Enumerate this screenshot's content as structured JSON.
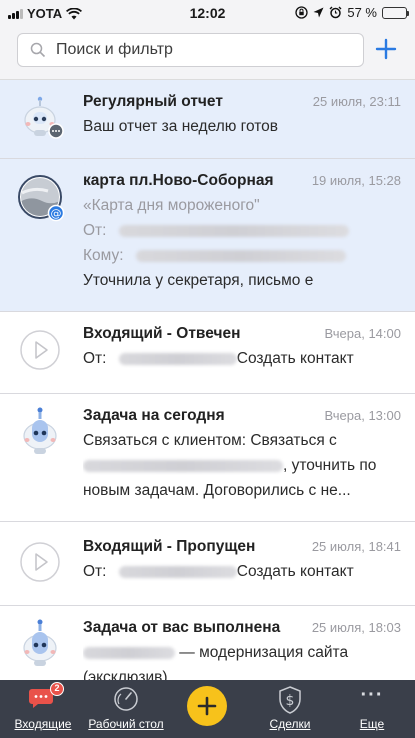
{
  "status_bar": {
    "carrier": "YOTA",
    "time": "12:02",
    "battery": "57 %",
    "battery_level": 0.57
  },
  "search": {
    "placeholder": "Поиск и фильтр"
  },
  "feed": [
    {
      "title": "Регулярный отчет",
      "time": "25 июля, 23:11",
      "line1": "Ваш отчет за неделю готов"
    },
    {
      "title": "карта пл.Ново-Соборная",
      "time": "19 июля, 15:28",
      "line1": "«Карта дня мороженого\"",
      "from_label": "От:",
      "to_label": "Кому:",
      "snippet": "Уточнила у секретаря, письмо е"
    },
    {
      "title": "Входящий - Отвечен",
      "time": "Вчера, 14:00",
      "from_label": "От:",
      "action": "Создать контакт"
    },
    {
      "title": "Задача на сегодня",
      "time": "Вчера, 13:00",
      "line1": "Связаться с клиентом: Связаться с",
      "line2_tail": ", уточнить по",
      "line3": "новым задачам.  Договорились с не..."
    },
    {
      "title": "Входящий - Пропущен",
      "time": "25 июля, 18:41",
      "from_label": "От:",
      "action": "Создать контакт"
    },
    {
      "title": "Задача от вас выполнена",
      "time": "25 июля, 18:03",
      "line1_tail": " — модернизация сайта",
      "line2": "(эксклюзив)"
    }
  ],
  "tabbar": {
    "inbox": "Входящие",
    "inbox_badge": "2",
    "desk": "Рабочий стол",
    "deals": "Сделки",
    "more": "Еще",
    "more_icon": "···"
  },
  "colors": {
    "accent": "#2a7ae2",
    "highlight": "#e6eefb",
    "tabbar": "#3a3f4a",
    "fab": "#f7c21b",
    "badge": "#e9524a"
  }
}
